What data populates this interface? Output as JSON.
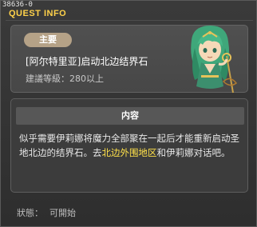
{
  "window": {
    "quest_id": "38636-0",
    "title": "QUEST INFO"
  },
  "header": {
    "badge": "主要",
    "quest_name": "[阿尔特里亚]启动北边结界石",
    "level_label": "建議等級：",
    "level_value": "280以上"
  },
  "content": {
    "heading": "内容",
    "text_part1": "似乎需要伊莉娜将魔力全部聚在一起后才能重新启动圣地北边的结界石。去",
    "text_highlight": "北边外围地区",
    "text_part2": "和伊莉娜对话吧。"
  },
  "status": {
    "label": "狀態：",
    "value": "可開始"
  },
  "colors": {
    "title": "#ffd24a",
    "highlight": "#ffe14a",
    "badge": "#b5a287"
  },
  "icons": {
    "npc": "green-haired-character-portrait"
  }
}
